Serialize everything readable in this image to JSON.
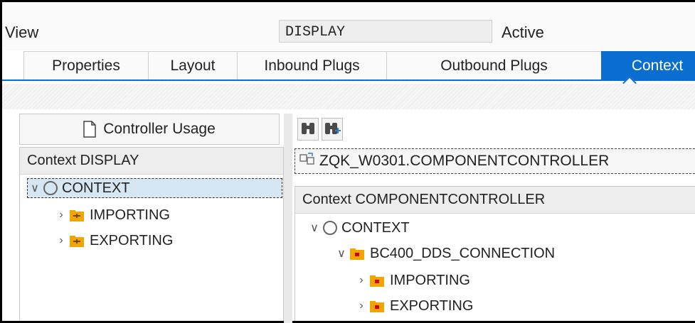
{
  "header": {
    "view_label": "View",
    "view_name": "DISPLAY",
    "view_status": "Active"
  },
  "tabs": [
    {
      "label": "Properties",
      "active": false
    },
    {
      "label": "Layout",
      "active": false
    },
    {
      "label": "Inbound Plugs",
      "active": false
    },
    {
      "label": "Outbound Plugs",
      "active": false
    },
    {
      "label": "Context",
      "active": true
    }
  ],
  "left": {
    "controller_usage_label": "Controller Usage",
    "panel_title": "Context DISPLAY",
    "tree": [
      {
        "label": "CONTEXT",
        "icon": "circle-node-icon",
        "expanded": true,
        "selected": true
      },
      {
        "label": "IMPORTING",
        "icon": "folder-mapped-icon",
        "expanded": false
      },
      {
        "label": "EXPORTING",
        "icon": "folder-mapped-icon",
        "expanded": false
      }
    ]
  },
  "right": {
    "toolbar": [
      "find-icon",
      "find-next-icon"
    ],
    "controller_name": "ZQK_W0301.COMPONENTCONTROLLER",
    "panel_title": "Context COMPONENTCONTROLLER",
    "tree": [
      {
        "label": "CONTEXT",
        "icon": "circle-node-icon",
        "expanded": true
      },
      {
        "label": "BC400_DDS_CONNECTION",
        "icon": "folder-node-icon",
        "expanded": true
      },
      {
        "label": "IMPORTING",
        "icon": "folder-node-icon",
        "expanded": false
      },
      {
        "label": "EXPORTING",
        "icon": "folder-node-icon",
        "expanded": false
      }
    ]
  },
  "colors": {
    "accent": "#0a6ed1",
    "folder": "#f0a500",
    "selection": "#d6e6f3"
  }
}
